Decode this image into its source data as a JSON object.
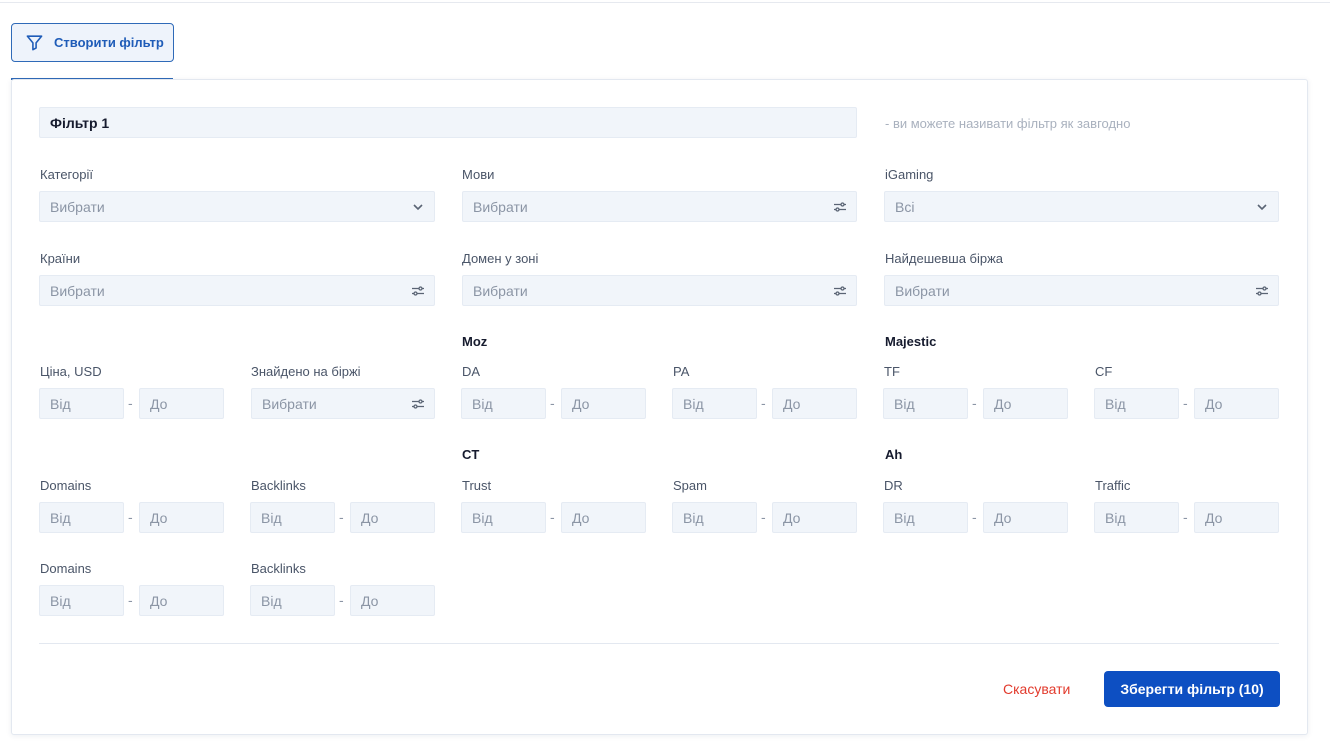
{
  "header": {
    "create_filter_label": "Створити фільтр"
  },
  "filter": {
    "name_value": "Фільтр 1",
    "name_hint": "- ви можете називати фільтр як завгодно"
  },
  "selects": {
    "categories": {
      "label": "Категорії",
      "value": "Вибрати"
    },
    "languages": {
      "label": "Мови",
      "value": "Вибрати"
    },
    "igaming": {
      "label": "iGaming",
      "value": "Всі"
    },
    "countries": {
      "label": "Країни",
      "value": "Вибрати"
    },
    "domain_zone": {
      "label": "Домен у зоні",
      "value": "Вибрати"
    },
    "cheapest_exchange": {
      "label": "Найдешевша біржа",
      "value": "Вибрати"
    },
    "found_on_exchange": {
      "label": "Знайдено на біржі",
      "value": "Вибрати"
    }
  },
  "groups": {
    "moz": "Moz",
    "majestic": "Majestic",
    "ct": "CT",
    "ah": "Ah"
  },
  "range": {
    "from": "Від",
    "to": "До",
    "sep": "-"
  },
  "ranges": {
    "price": "Ціна, USD",
    "da": "DA",
    "pa": "PA",
    "tf": "TF",
    "cf": "CF",
    "domains_1": "Domains",
    "backlinks_1": "Backlinks",
    "trust": "Trust",
    "spam": "Spam",
    "dr": "DR",
    "traffic": "Traffic",
    "domains_2": "Domains",
    "backlinks_2": "Backlinks"
  },
  "footer": {
    "cancel_label": "Скасувати",
    "save_label": "Зберегти фільтр (10)"
  },
  "icons": {
    "create": "filter-icon",
    "dropdown": "chevron-down-icon",
    "multi": "sliders-icon"
  },
  "colors": {
    "accent": "#0d4fc2",
    "danger": "#e23a2c",
    "field_bg": "#f1f5fa"
  }
}
